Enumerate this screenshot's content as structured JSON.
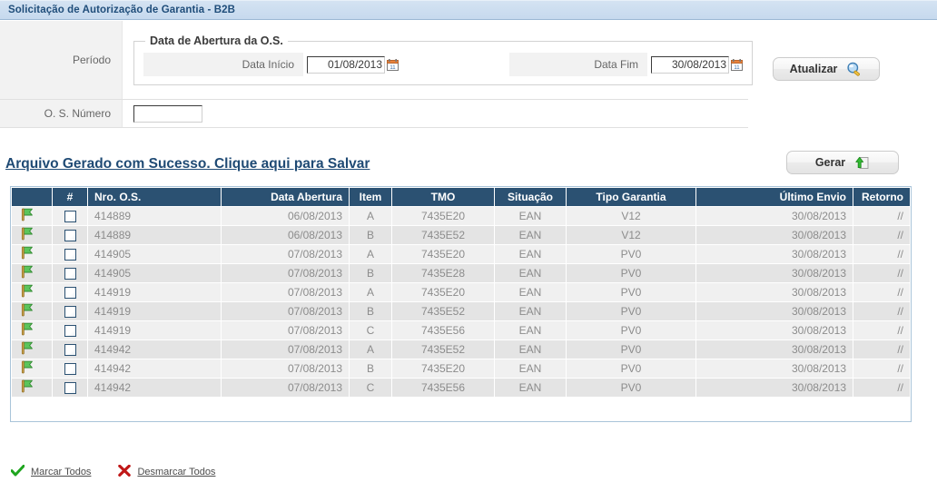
{
  "window": {
    "title": "Solicitação de Autorização de Garantia - B2B"
  },
  "form": {
    "periodo_label": "Período",
    "os_numero_label": "O. S. Número",
    "os_numero_value": "",
    "os_numero_placeholder": "",
    "fieldset_legend": "Data de Abertura da O.S.",
    "data_inicio_label": "Data Início",
    "data_inicio_value": "01/08/2013",
    "data_fim_label": "Data Fim",
    "data_fim_value": "30/08/2013"
  },
  "buttons": {
    "atualizar": "Atualizar",
    "gerar": "Gerar"
  },
  "message": {
    "save_link": "Arquivo Gerado com Sucesso. Clique aqui para Salvar"
  },
  "grid": {
    "columns": [
      "",
      "#",
      "Nro. O.S.",
      "Data Abertura",
      "Item",
      "TMO",
      "Situação",
      "Tipo Garantia",
      "Último Envio",
      "Retorno"
    ],
    "rows": [
      {
        "os": "414889",
        "data_abertura": "06/08/2013",
        "item": "A",
        "tmo": "7435E20",
        "situacao": "EAN",
        "tipo_garantia": "V12",
        "ultimo_envio": "30/08/2013",
        "retorno": "//"
      },
      {
        "os": "414889",
        "data_abertura": "06/08/2013",
        "item": "B",
        "tmo": "7435E52",
        "situacao": "EAN",
        "tipo_garantia": "V12",
        "ultimo_envio": "30/08/2013",
        "retorno": "//"
      },
      {
        "os": "414905",
        "data_abertura": "07/08/2013",
        "item": "A",
        "tmo": "7435E20",
        "situacao": "EAN",
        "tipo_garantia": "PV0",
        "ultimo_envio": "30/08/2013",
        "retorno": "//"
      },
      {
        "os": "414905",
        "data_abertura": "07/08/2013",
        "item": "B",
        "tmo": "7435E28",
        "situacao": "EAN",
        "tipo_garantia": "PV0",
        "ultimo_envio": "30/08/2013",
        "retorno": "//"
      },
      {
        "os": "414919",
        "data_abertura": "07/08/2013",
        "item": "A",
        "tmo": "7435E20",
        "situacao": "EAN",
        "tipo_garantia": "PV0",
        "ultimo_envio": "30/08/2013",
        "retorno": "//"
      },
      {
        "os": "414919",
        "data_abertura": "07/08/2013",
        "item": "B",
        "tmo": "7435E52",
        "situacao": "EAN",
        "tipo_garantia": "PV0",
        "ultimo_envio": "30/08/2013",
        "retorno": "//"
      },
      {
        "os": "414919",
        "data_abertura": "07/08/2013",
        "item": "C",
        "tmo": "7435E56",
        "situacao": "EAN",
        "tipo_garantia": "PV0",
        "ultimo_envio": "30/08/2013",
        "retorno": "//"
      },
      {
        "os": "414942",
        "data_abertura": "07/08/2013",
        "item": "A",
        "tmo": "7435E52",
        "situacao": "EAN",
        "tipo_garantia": "PV0",
        "ultimo_envio": "30/08/2013",
        "retorno": "//"
      },
      {
        "os": "414942",
        "data_abertura": "07/08/2013",
        "item": "B",
        "tmo": "7435E20",
        "situacao": "EAN",
        "tipo_garantia": "PV0",
        "ultimo_envio": "30/08/2013",
        "retorno": "//"
      },
      {
        "os": "414942",
        "data_abertura": "07/08/2013",
        "item": "C",
        "tmo": "7435E56",
        "situacao": "EAN",
        "tipo_garantia": "PV0",
        "ultimo_envio": "30/08/2013",
        "retorno": "//"
      }
    ]
  },
  "footer": {
    "marcar_todos": "Marcar Todos",
    "desmarcar_todos": "Desmarcar Todos"
  },
  "icons": {
    "calendar": "calendar-icon",
    "search": "search-icon",
    "upload": "upload-icon",
    "flag": "flag-icon",
    "check": "check-icon",
    "cross": "cross-icon"
  },
  "colors": {
    "titlebar_bg": "#c6d9ee",
    "titlebar_text": "#1f4d7a",
    "header_bg": "#2b5172",
    "link": "#1f4a74",
    "row_odd": "#f0f0f0",
    "row_even": "#e4e4e4",
    "grid_border": "#a9c4d9"
  }
}
